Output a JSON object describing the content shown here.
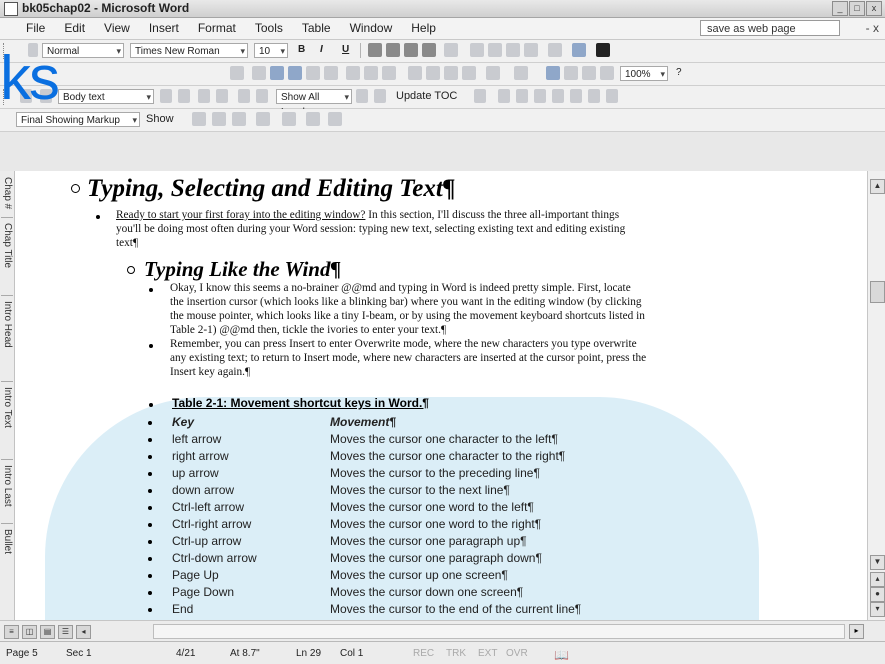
{
  "window": {
    "title": "bk05chap02 - Microsoft Word",
    "controls": [
      "_",
      "□",
      "x"
    ]
  },
  "menu": {
    "items": [
      "File",
      "Edit",
      "View",
      "Insert",
      "Format",
      "Tools",
      "Table",
      "Window",
      "Help"
    ],
    "help_box": "save as web page",
    "close": "- x"
  },
  "formatting_toolbar": {
    "style": "Normal",
    "font": "Times New Roman",
    "size": "10",
    "bold": "B",
    "italic": "I",
    "underline": "U"
  },
  "standard_toolbar": {
    "zoom": "100%",
    "help": "?"
  },
  "outlining_toolbar": {
    "level": "Body text",
    "show_level": "Show All Levels",
    "update_toc": "Update TOC"
  },
  "reviewing_toolbar": {
    "markup": "Final Showing Markup",
    "show": "Show"
  },
  "style_area": [
    "Chap #",
    "Chap Title",
    "Intro Head",
    "Intro Text",
    "Intro Last",
    "Bullet"
  ],
  "document": {
    "heading1": "Typing, Selecting and Editing Text¶",
    "intro_link": "Ready to start your first foray into the editing window?",
    "intro_line1": "In this section, I'll discuss the three all-important things",
    "intro_line2": "you'll be doing most often during your Word session:  typing new text, selecting existing text and editing existing",
    "intro_line3": "text¶",
    "heading2": "Typing Like the Wind¶",
    "p1": [
      "Okay, I know this seems a no-brainer @@md and typing in Word is indeed pretty simple.  First, locate",
      "the insertion cursor (which looks like a blinking bar) where you want in the editing window (by clicking",
      "the mouse pointer, which looks like a tiny I-beam, or by using the movement keyboard shortcuts listed in",
      "Table 2-1) @@md then, tickle the ivories to enter your text.¶"
    ],
    "p2": [
      "Remember, you can press Insert to enter Overwrite mode, where the new characters you type overwrite",
      "any existing text; to return to Insert mode, where new characters are inserted at the cursor point, press the",
      "Insert key again.¶"
    ],
    "table_caption": "Table 2-1:  Movement shortcut keys in Word.¶",
    "table_header": {
      "key": "Key",
      "movement": "Movement¶"
    },
    "rows": [
      {
        "key": "left arrow",
        "movement": "Moves the cursor one character to the left¶"
      },
      {
        "key": "right arrow",
        "movement": "Moves the cursor one character to the right¶"
      },
      {
        "key": "up arrow",
        "movement": "Moves the cursor to the preceding line¶"
      },
      {
        "key": "down arrow",
        "movement": "Moves the cursor to the next line¶"
      },
      {
        "key": "Ctrl-left arrow",
        "movement": "Moves the cursor one word to the left¶"
      },
      {
        "key": "Ctrl-right arrow",
        "movement": "Moves the cursor one word to the right¶"
      },
      {
        "key": "Ctrl-up arrow",
        "movement": "Moves the cursor one paragraph up¶"
      },
      {
        "key": "Ctrl-down arrow",
        "movement": "Moves the cursor one paragraph down¶"
      },
      {
        "key": "Page Up",
        "movement": "Moves the cursor up one screen¶"
      },
      {
        "key": "Page Down",
        "movement": "Moves the cursor down one screen¶"
      },
      {
        "key": "End",
        "movement": "Moves the cursor to the end of the current line¶"
      }
    ]
  },
  "status": {
    "page": "Page 5",
    "sec": "Sec 1",
    "pages": "4/21",
    "at": "At 8.7\"",
    "ln": "Ln 29",
    "col": "Col 1",
    "rec": "REC",
    "trk": "TRK",
    "ext": "EXT",
    "ovr": "OVR"
  },
  "overlay_text": "ks"
}
